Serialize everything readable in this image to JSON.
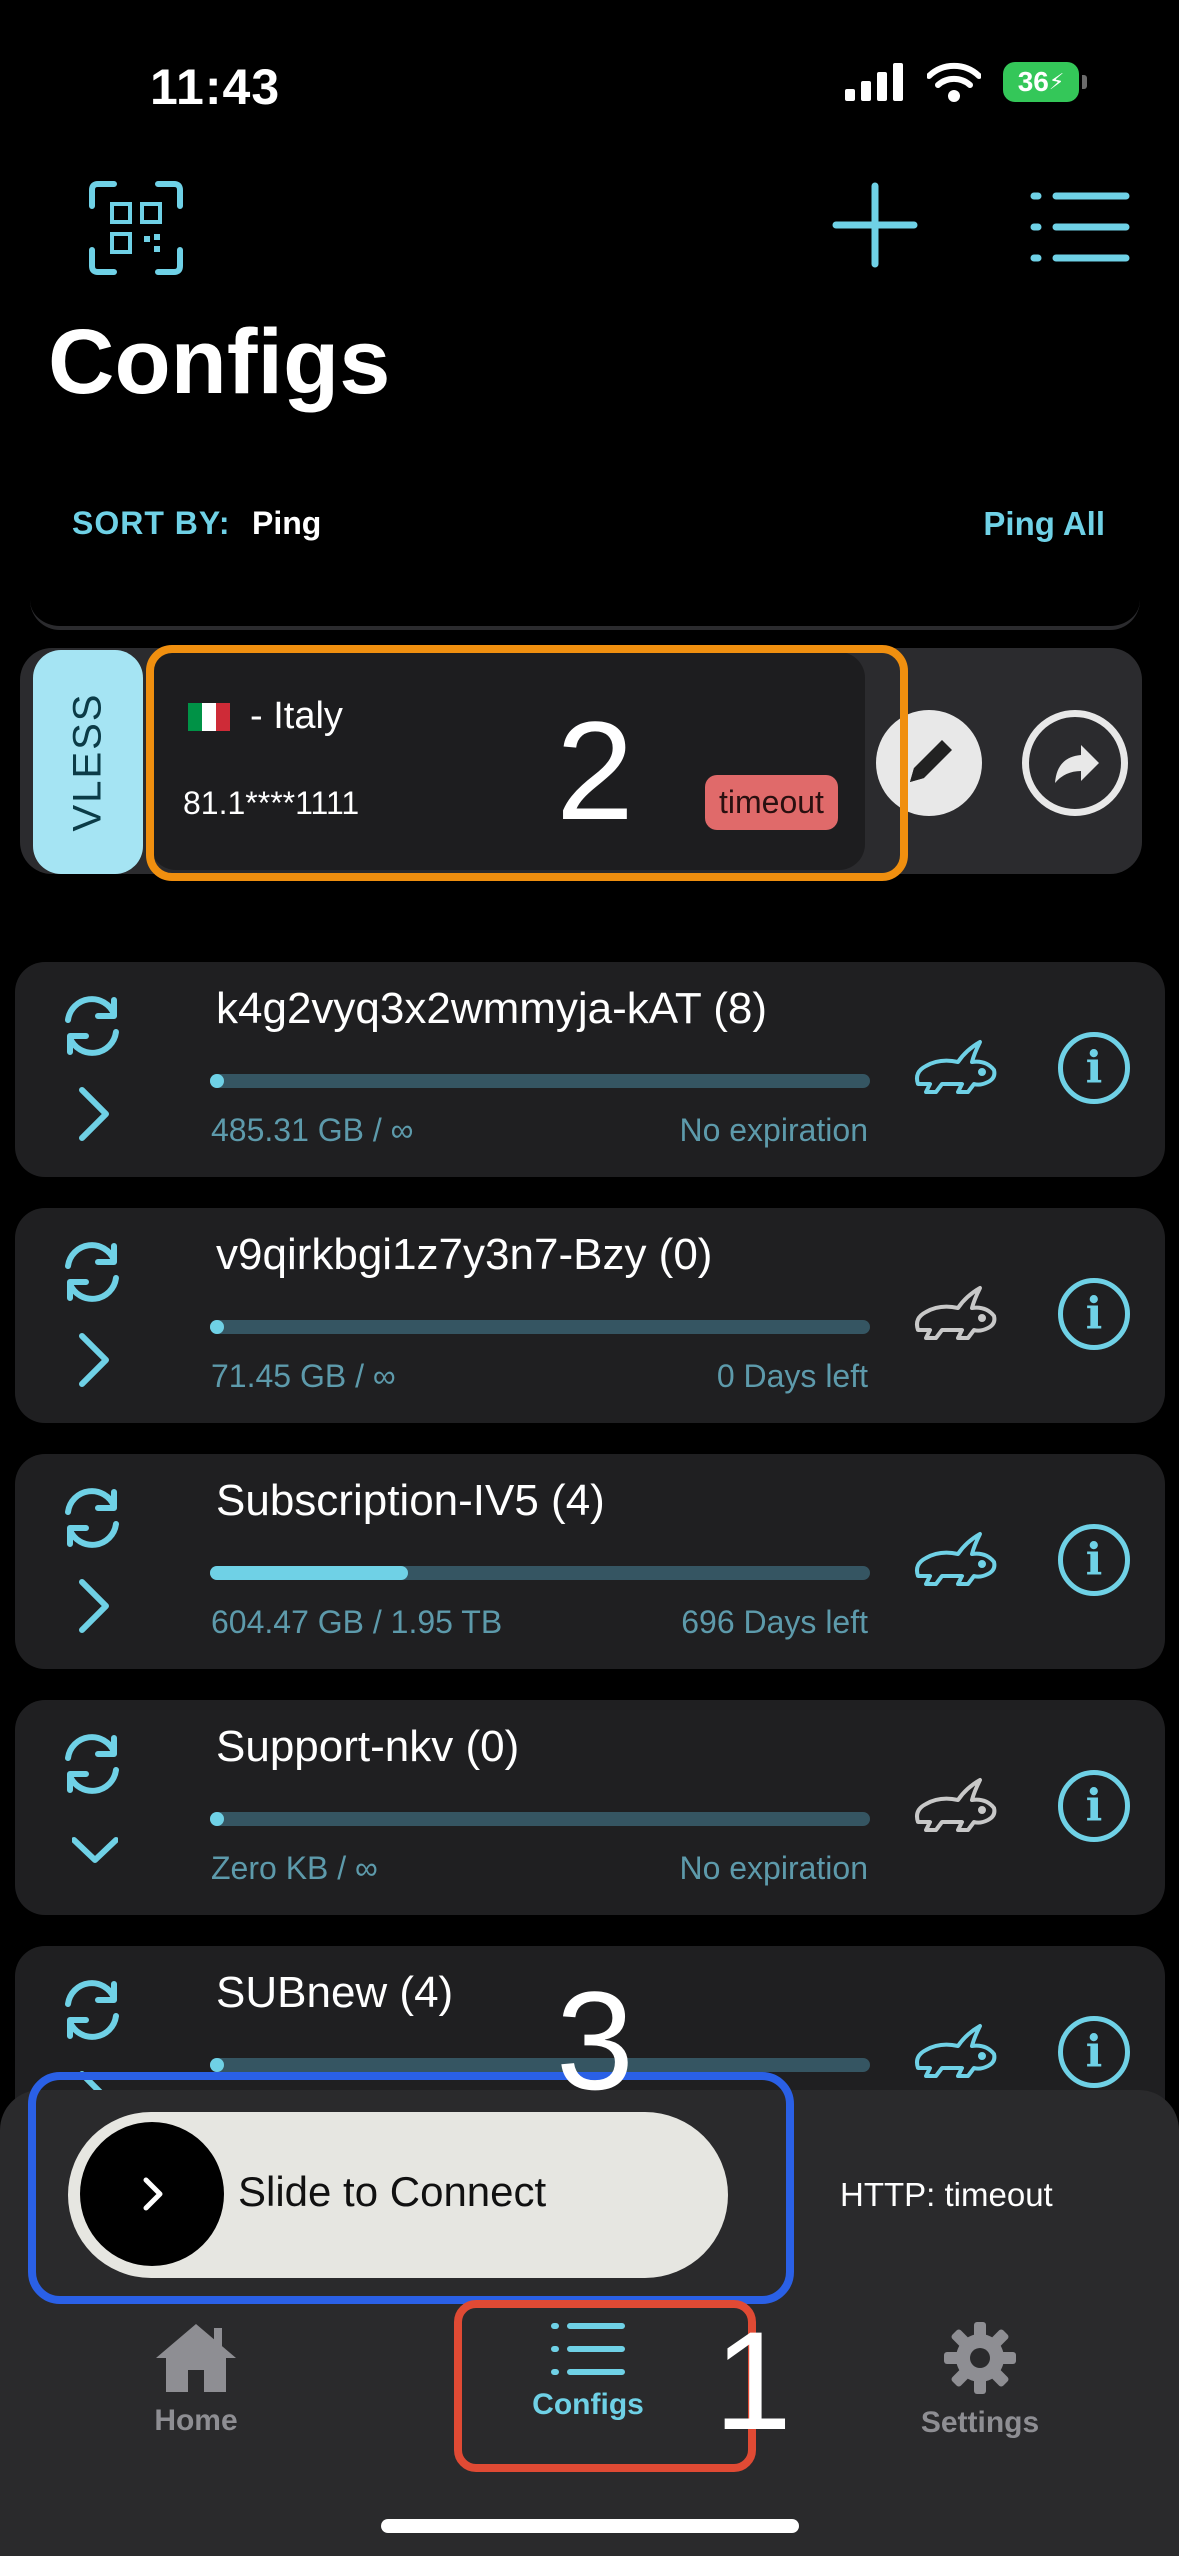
{
  "status_bar": {
    "time": "11:43",
    "battery": "36"
  },
  "header": {
    "title": "Configs"
  },
  "sort": {
    "label": "SORT BY:",
    "value": "Ping",
    "ping_all": "Ping All"
  },
  "config": {
    "protocol": "VLESS",
    "country": "- Italy",
    "address": "81.1****1111",
    "status": "timeout",
    "flag_colors": [
      "#009246",
      "#ffffff",
      "#ce2b37"
    ]
  },
  "subscriptions": [
    {
      "name": "k4g2vyq3x2wmmyja-kAT (8)",
      "usage": "485.31 GB / ∞",
      "expiration": "No expiration",
      "progress": 0.015,
      "expanded": false,
      "active": true
    },
    {
      "name": "v9qirkbgi1z7y3n7-Bzy (0)",
      "usage": "71.45 GB / ∞",
      "expiration": "0 Days left",
      "progress": 0.015,
      "expanded": false,
      "active": false
    },
    {
      "name": "Subscription-IV5 (4)",
      "usage": "604.47 GB / 1.95 TB",
      "expiration": "696 Days left",
      "progress": 0.3,
      "expanded": false,
      "active": true
    },
    {
      "name": "Support-nkv (0)",
      "usage": "Zero KB / ∞",
      "expiration": "No expiration",
      "progress": 0.015,
      "expanded": true,
      "active": false
    },
    {
      "name": "SUBnew (4)",
      "usage": "",
      "expiration": "",
      "progress": 0.015,
      "expanded": false,
      "active": true
    }
  ],
  "connect": {
    "slider_label": "Slide to Connect",
    "http_status": "HTTP: timeout"
  },
  "tabs": [
    {
      "label": "Home",
      "active": false
    },
    {
      "label": "Configs",
      "active": true
    },
    {
      "label": "Settings",
      "active": false
    }
  ],
  "annotations": {
    "one": "1",
    "two": "2",
    "three": "3"
  },
  "colors": {
    "accent": "#6fd1e6",
    "timeout": "#e06a6a",
    "vless": "#a5e4f3",
    "annotation_orange": "#f08f0f",
    "annotation_blue": "#2a60e6",
    "annotation_red": "#e04a34"
  }
}
